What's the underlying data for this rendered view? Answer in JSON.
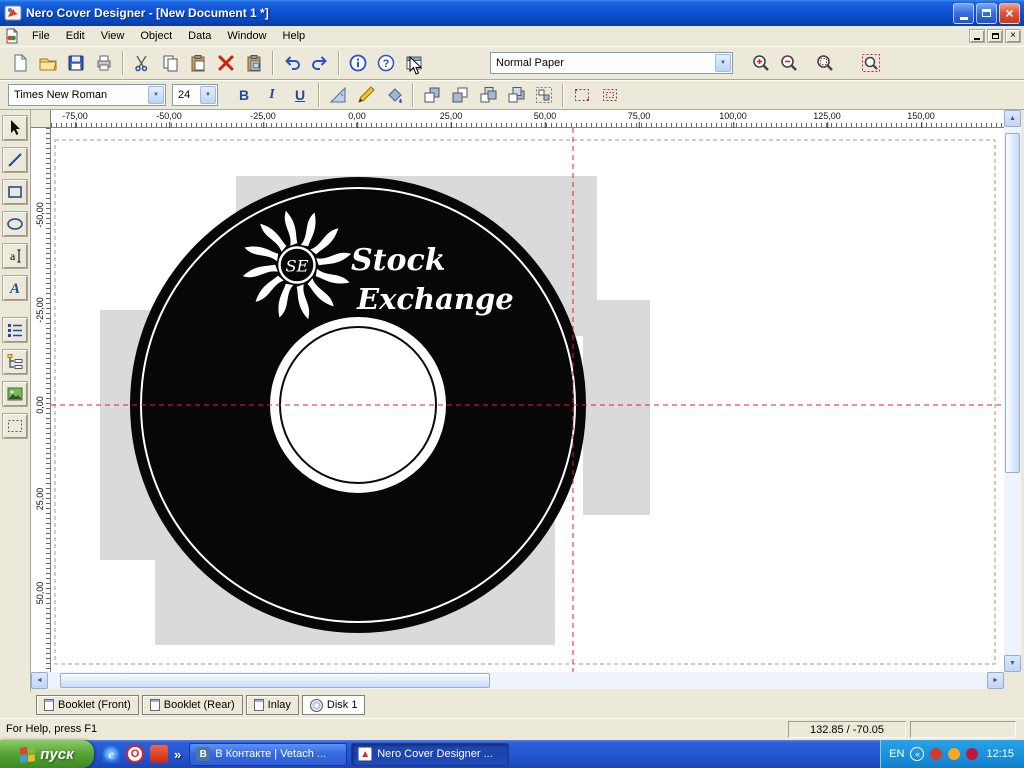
{
  "titlebar": {
    "title": "Nero Cover Designer - [New Document 1 *]"
  },
  "menubar": {
    "items": [
      "File",
      "Edit",
      "View",
      "Object",
      "Data",
      "Window",
      "Help"
    ]
  },
  "toolbar_main": {
    "paper_combo_value": "Normal Paper"
  },
  "toolbar_format": {
    "font_combo_value": "Times New Roman",
    "size_combo_value": "24",
    "bold_label": "B",
    "italic_label": "I",
    "underline_label": "U"
  },
  "rulers": {
    "horizontal": [
      "-75,00",
      "-50,00",
      "-25,00",
      "0,00",
      "25,00",
      "50,00",
      "75,00",
      "100,00",
      "125,00",
      "150,00"
    ],
    "vertical": [
      "-50,00",
      "-25,00",
      "0,00",
      "25,00",
      "50,00"
    ]
  },
  "canvas": {
    "disc_label_line1": "Stock",
    "disc_label_line2": "Exchange",
    "logo_monogram": "SE"
  },
  "tabbar": {
    "tabs": [
      {
        "label": "Booklet (Front)"
      },
      {
        "label": "Booklet (Rear)"
      },
      {
        "label": "Inlay"
      },
      {
        "label": "Disk 1"
      }
    ]
  },
  "statusbar": {
    "help_text": "For Help, press F1",
    "coordinates": "132.85 / -70.05"
  },
  "taskbar": {
    "start_label": "пуск",
    "quick_launch_overflow": "»",
    "tasks": [
      {
        "label": "В Контакте | Vetach ..."
      },
      {
        "label": "Nero Cover Designer ..."
      }
    ],
    "tray": {
      "language": "EN",
      "clock": "12:15"
    }
  },
  "icons": {
    "close_glyph": "×",
    "dropdown_glyph": "▼",
    "scroll_up_glyph": "▲",
    "scroll_down_glyph": "▼",
    "scroll_left_glyph": "◄",
    "scroll_right_glyph": "►",
    "text_tool_glyph": "a",
    "art_text_glyph": "A",
    "help_glyph": "?",
    "ie_glyph": "e",
    "opera_glyph": "O",
    "vk_glyph": "B",
    "tray_chevron_glyph": "«"
  }
}
